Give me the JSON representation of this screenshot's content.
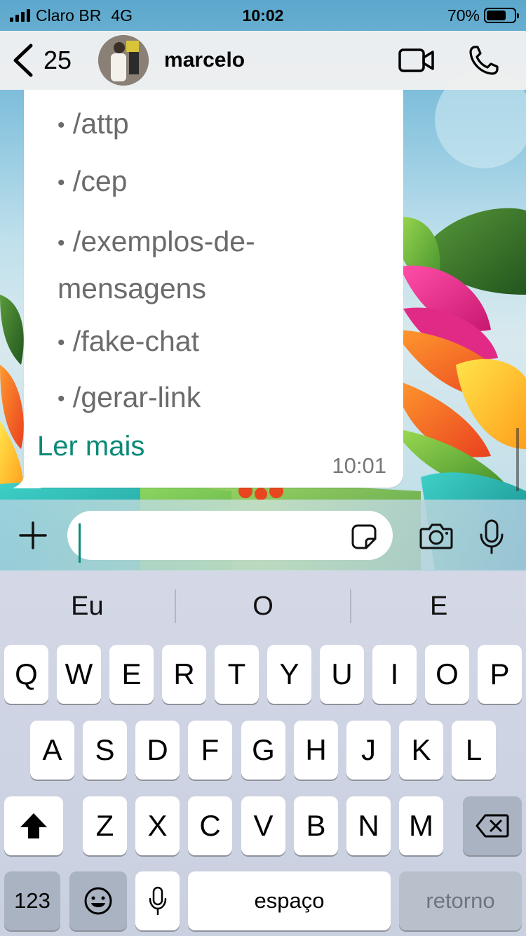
{
  "status_bar": {
    "carrier": "Claro BR",
    "network": "4G",
    "time": "10:02",
    "battery_percent": "70%",
    "battery_level": 0.7
  },
  "nav": {
    "back_count": "25",
    "contact_name": "marcelo",
    "icons": [
      "chevron-left-icon",
      "video-call-icon",
      "phone-icon"
    ]
  },
  "message": {
    "commands": [
      "• /attp",
      "• /cep",
      "• /exemplos-de-mensagens",
      "• /fake-chat",
      "• /gerar-link"
    ],
    "cmd_attp": "/attp",
    "cmd_cep": "/cep",
    "cmd_exemplos_line1": "/exemplos-de-",
    "cmd_exemplos_line2": "mensagens",
    "cmd_fake_chat": "/fake-chat",
    "cmd_gerar_link": "/gerar-link",
    "bullet": "•",
    "read_more": "Ler mais",
    "time": "10:01"
  },
  "composer": {
    "value": "",
    "placeholder": "",
    "icons": [
      "plus-icon",
      "sticker-icon",
      "camera-icon",
      "microphone-icon"
    ]
  },
  "keyboard": {
    "suggestions": [
      "Eu",
      "O",
      "E"
    ],
    "row1": [
      "Q",
      "W",
      "E",
      "R",
      "T",
      "Y",
      "U",
      "I",
      "O",
      "P"
    ],
    "row2": [
      "A",
      "S",
      "D",
      "F",
      "G",
      "H",
      "J",
      "K",
      "L"
    ],
    "row3": [
      "Z",
      "X",
      "C",
      "V",
      "B",
      "N",
      "M"
    ],
    "numbers_key": "123",
    "space_key": "espaço",
    "return_key": "retorno"
  },
  "colors": {
    "accent": "#0b8a78",
    "bubble": "#ffffff",
    "command_text": "#6b6b6b"
  }
}
